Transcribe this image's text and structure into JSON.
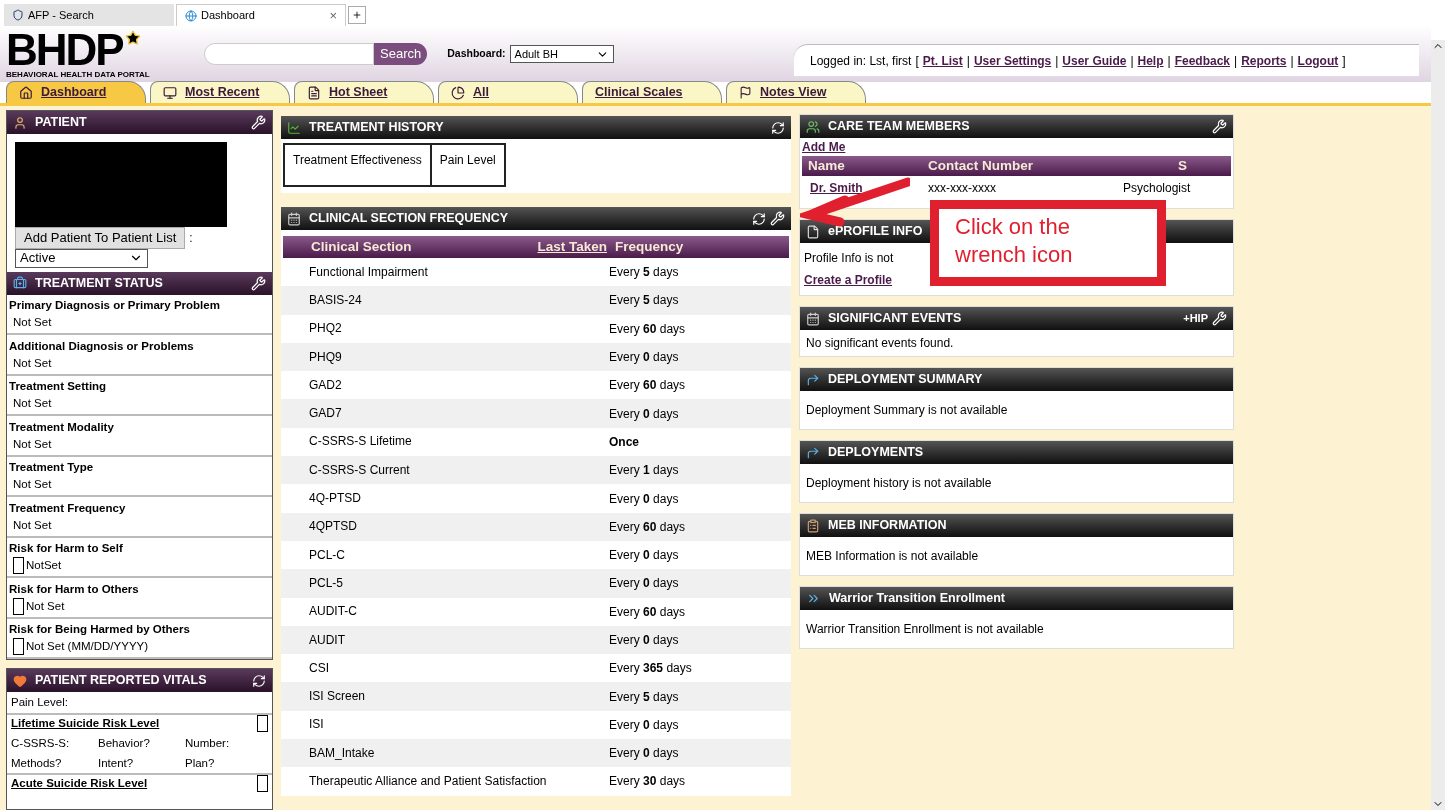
{
  "browser_tabs": [
    {
      "label": "AFP - Search",
      "selected": false
    },
    {
      "label": "Dashboard",
      "selected": true,
      "close": "×"
    }
  ],
  "header": {
    "logo": "BHDP",
    "logo_subtitle": "BEHAVIORAL HEALTH DATA PORTAL",
    "search_button": "Search",
    "dashboard_label": "Dashboard:",
    "dashboard_value": "Adult BH",
    "logged_in": "Logged in: Lst, first",
    "open_bracket": "[",
    "close_bracket": "]",
    "separator": "|",
    "links": [
      "Pt. List",
      "User Settings",
      "User Guide",
      "Help",
      "Feedback",
      "Reports",
      "Logout"
    ]
  },
  "tabs": [
    {
      "label": "Dashboard",
      "selected": true,
      "kind": "home"
    },
    {
      "label": "Most Recent",
      "selected": false,
      "kind": "monitor"
    },
    {
      "label": "Hot Sheet",
      "selected": false,
      "kind": "sheet"
    },
    {
      "label": "All",
      "selected": false,
      "kind": "pie"
    },
    {
      "label": "Clinical Scales",
      "selected": false,
      "kind": "none"
    },
    {
      "label": "Notes View",
      "selected": false,
      "kind": "flag"
    }
  ],
  "patient": {
    "title": "PATIENT",
    "add_button": "Add Patient To Patient List",
    "colon": ":",
    "status": "Active"
  },
  "treatment_status": {
    "title": "TREATMENT STATUS",
    "items": [
      {
        "label": "Primary Diagnosis or Primary Problem",
        "value": "Not Set",
        "kind": "text"
      },
      {
        "label": "Additional Diagnosis or Problems",
        "value": "Not Set",
        "kind": "text"
      },
      {
        "label": "Treatment Setting",
        "value": "Not Set",
        "kind": "text"
      },
      {
        "label": "Treatment Modality",
        "value": "Not Set",
        "kind": "text"
      },
      {
        "label": "Treatment Type",
        "value": "Not Set",
        "kind": "text"
      },
      {
        "label": "Treatment Frequency",
        "value": "Not Set",
        "kind": "text"
      },
      {
        "label": "Risk for Harm to Self",
        "value": "NotSet",
        "kind": "check",
        "checked": false
      },
      {
        "label": "Risk for Harm to Others",
        "value": "Not Set",
        "kind": "check",
        "checked": false
      },
      {
        "label": "Risk for Being Harmed by Others",
        "value": "Not Set (MM/DD/YYYY)",
        "kind": "check",
        "checked": false
      }
    ]
  },
  "vitals": {
    "title": "PATIENT REPORTED VITALS",
    "pain_level": "Pain Level:",
    "lifetime": {
      "title": "Lifetime Suicide Risk Level",
      "checked": false,
      "cells": [
        "C-SSRS-S:",
        "Behavior?",
        "Number:",
        "Methods?",
        "Intent?",
        "Plan?"
      ]
    },
    "acute": {
      "title": "Acute Suicide Risk Level",
      "checked": false
    }
  },
  "treatment_history": {
    "title": "TREATMENT HISTORY",
    "tabs": [
      "Treatment Effectiveness",
      "Pain Level"
    ]
  },
  "clinical_section_frequency": {
    "title": "CLINICAL SECTION FREQUENCY",
    "columns": [
      "Clinical Section",
      "Last Taken",
      "Frequency"
    ],
    "rows": [
      {
        "section": "Functional Impairment",
        "frequency": "Every **5** days"
      },
      {
        "section": "BASIS-24",
        "frequency": "Every **5** days"
      },
      {
        "section": "PHQ2",
        "frequency": "Every **60** days"
      },
      {
        "section": "PHQ9",
        "frequency": "Every **0** days"
      },
      {
        "section": "GAD2",
        "frequency": "Every **60** days"
      },
      {
        "section": "GAD7",
        "frequency": "Every **0** days"
      },
      {
        "section": "C-SSRS-S Lifetime",
        "frequency": "**Once**"
      },
      {
        "section": "C-SSRS-S Current",
        "frequency": "Every **1** days"
      },
      {
        "section": "4Q-PTSD",
        "frequency": "Every **0** days"
      },
      {
        "section": "4QPTSD",
        "frequency": "Every **60** days"
      },
      {
        "section": "PCL-C",
        "frequency": "Every **0** days"
      },
      {
        "section": "PCL-5",
        "frequency": "Every **0** days"
      },
      {
        "section": "AUDIT-C",
        "frequency": "Every **60** days"
      },
      {
        "section": "AUDIT",
        "frequency": "Every **0** days"
      },
      {
        "section": "CSI",
        "frequency": "Every **365** days"
      },
      {
        "section": "ISI Screen",
        "frequency": "Every **5** days"
      },
      {
        "section": "ISI",
        "frequency": "Every **0** days"
      },
      {
        "section": "BAM_Intake",
        "frequency": "Every **0** days"
      },
      {
        "section": "Therapeutic Alliance and Patient Satisfaction",
        "frequency": "Every **30** days"
      }
    ]
  },
  "care_team": {
    "title": "CARE TEAM MEMBERS",
    "add_me": "Add Me",
    "columns": [
      "Name",
      "Contact Number",
      "S"
    ],
    "rows": [
      {
        "name": "Dr. Smith",
        "contact": "xxx-xxx-xxxx",
        "column_3": "Psychologist"
      }
    ]
  },
  "eprofile": {
    "title": "ePROFILE INFO",
    "text": "Profile Info is not",
    "link": "Create a Profile"
  },
  "significant_events": {
    "title": "SIGNIFICANT EVENTS",
    "action": "+HIP",
    "text": "No significant events found."
  },
  "deployment_summary": {
    "title": "DEPLOYMENT SUMMARY",
    "text": "Deployment Summary is not available"
  },
  "deployments": {
    "title": "DEPLOYMENTS",
    "text": "Deployment history is not available"
  },
  "meb": {
    "title": "MEB INFORMATION",
    "text": "MEB Information is not available"
  },
  "warrior": {
    "title": "Warrior Transition Enrollment",
    "text": "Warrior Transition Enrollment is not available"
  },
  "callout": {
    "text": "Click on the wrench icon"
  }
}
